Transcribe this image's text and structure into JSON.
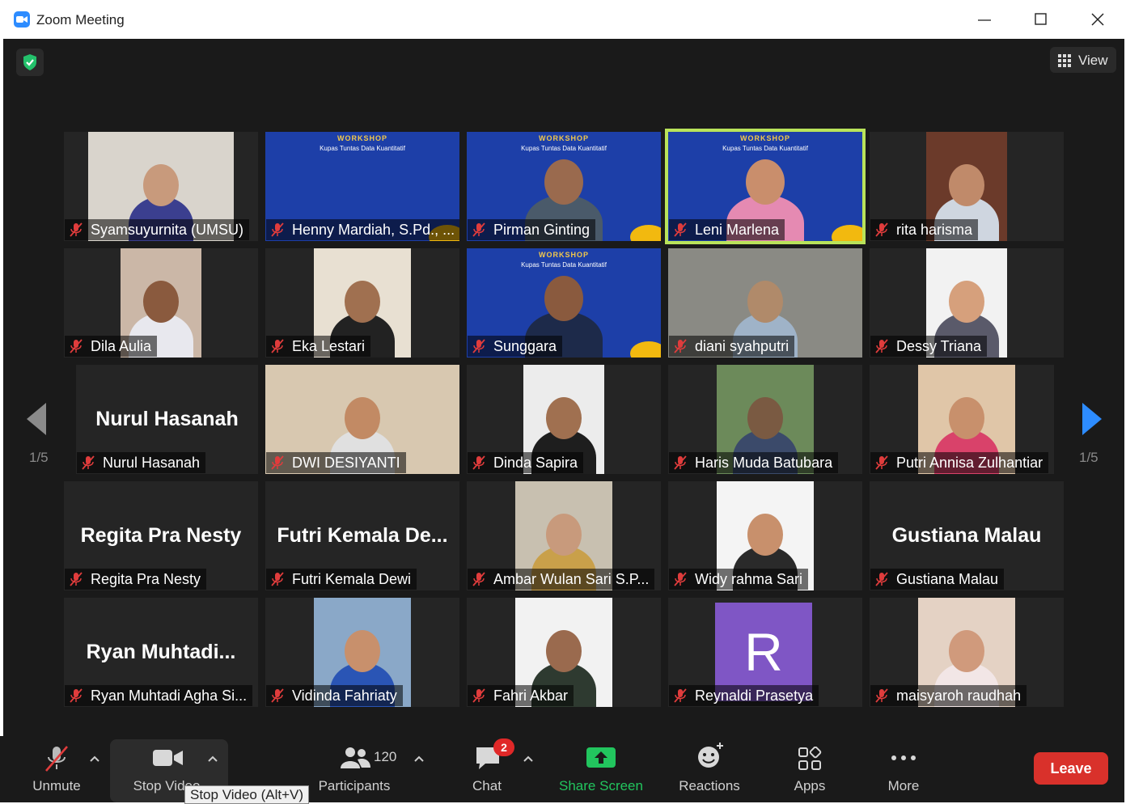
{
  "window": {
    "title": "Zoom Meeting",
    "controls": [
      "minimize",
      "maximize",
      "close"
    ]
  },
  "header": {
    "security_icon": "shield-check-icon",
    "view_label": "View"
  },
  "pagination": {
    "left": "1/5",
    "right": "1/5"
  },
  "banner": {
    "title": "WORKSHOP",
    "subtitle": "Kupas Tuntas Data Kuantitatif"
  },
  "participants": [
    {
      "name": "Syamsuyurnita (UMSU)"
    },
    {
      "name": "Henny Mardiah, S.Pd., ..."
    },
    {
      "name": "Pirman Ginting"
    },
    {
      "name": "Leni Marlena"
    },
    {
      "name": "rita harisma"
    },
    {
      "name": "Dila Aulia"
    },
    {
      "name": "Eka Lestari"
    },
    {
      "name": "Sunggara"
    },
    {
      "name": "diani syahputri"
    },
    {
      "name": "Dessy Triana"
    },
    {
      "name": "Nurul Hasanah",
      "display": "Nurul Hasanah"
    },
    {
      "name": "DWI DESIYANTI"
    },
    {
      "name": "Dinda Sapira"
    },
    {
      "name": "Haris Muda Batubara"
    },
    {
      "name": "Putri Annisa Zulhantiar"
    },
    {
      "name": "Regita Pra Nesty",
      "display": "Regita Pra Nesty"
    },
    {
      "name": "Futri Kemala Dewi",
      "display": "Futri  Kemala  De..."
    },
    {
      "name": "Ambar Wulan Sari S.P..."
    },
    {
      "name": "Widy rahma Sari"
    },
    {
      "name": "Gustiana Malau",
      "display": "Gustiana Malau"
    },
    {
      "name": "Ryan Muhtadi Agha Si...",
      "display": "Ryan  Muhtadi..."
    },
    {
      "name": "Vidinda Fahriaty"
    },
    {
      "name": "Fahri Akbar"
    },
    {
      "name": "Reynaldi Prasetya",
      "avatar": "R"
    },
    {
      "name": "maisyaroh raudhah"
    }
  ],
  "toolbar": {
    "unmute": "Unmute",
    "stop_video": "Stop Video",
    "participants": "Participants",
    "participant_count": "120",
    "chat": "Chat",
    "chat_badge": "2",
    "share_screen": "Share Screen",
    "reactions": "Reactions",
    "apps": "Apps",
    "more": "More",
    "leave": "Leave"
  },
  "tooltip": "Stop Video (Alt+V)",
  "colors": {
    "accent_blue": "#2d8cff",
    "share_green": "#22c55e",
    "leave_red": "#d9312b",
    "active_speaker": "#b9e35a",
    "muted_red": "#e03c3c"
  }
}
